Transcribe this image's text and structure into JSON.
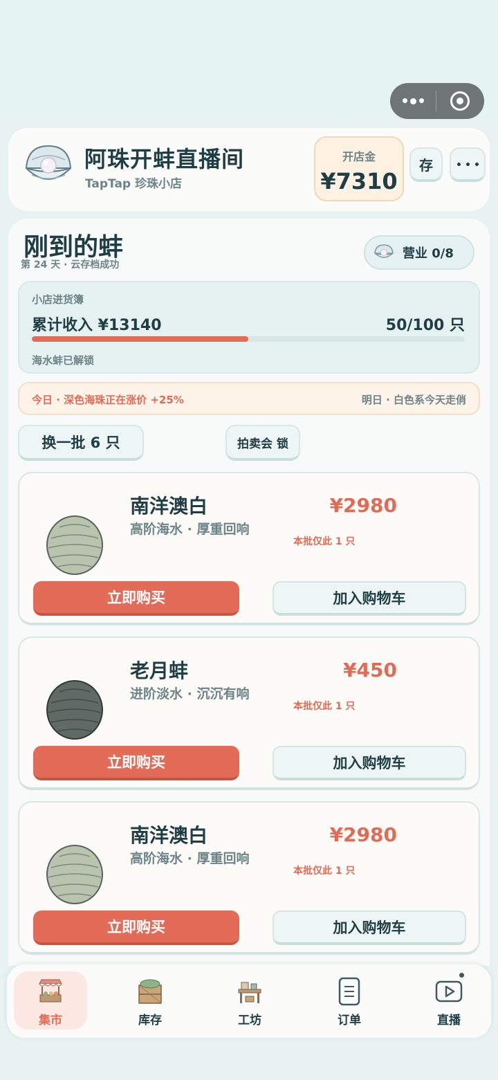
{
  "header": {
    "shop_title": "阿珠开蚌直播间",
    "shop_subtitle": "TapTap 珍珠小店",
    "gold_label": "开店金",
    "gold_value": "¥7310",
    "save_label": "存"
  },
  "page": {
    "title": "刚到的蚌",
    "subtitle": "第 24 天 · 云存档成功",
    "status_label": "营业 0/8"
  },
  "ledger": {
    "title": "小店进货簿",
    "income": "累计收入 ¥13140",
    "count": "50/100 只",
    "progress": 0.5,
    "note": "海水蚌已解锁"
  },
  "market": {
    "today": "今日 · 深色海珠正在涨价 +25%",
    "tomorrow": "明日 · 白色系今天走俏"
  },
  "actions": {
    "refresh_label": "换一批 6 只",
    "auction_label": "拍卖会 锁"
  },
  "products": [
    {
      "name": "南洋澳白",
      "desc": "高阶海水 · 厚重回响",
      "price": "¥2980",
      "stock": "本批仅此 1 只",
      "buy_label": "立即购买",
      "cart_label": "加入购物车",
      "shell_color": "#b9c3ad"
    },
    {
      "name": "老月蚌",
      "desc": "进阶淡水 · 沉沉有响",
      "price": "¥450",
      "stock": "本批仅此 1 只",
      "buy_label": "立即购买",
      "cart_label": "加入购物车",
      "shell_color": "#5f6a66"
    },
    {
      "name": "南洋澳白",
      "desc": "高阶海水 · 厚重回响",
      "price": "¥2980",
      "stock": "本批仅此 1 只",
      "buy_label": "立即购买",
      "cart_label": "加入购物车",
      "shell_color": "#b9c3ad"
    }
  ],
  "tabbar": {
    "tabs": [
      {
        "label": "集市",
        "icon": "market-stall-icon",
        "active": true
      },
      {
        "label": "库存",
        "icon": "crate-icon",
        "active": false
      },
      {
        "label": "工坊",
        "icon": "workbench-icon",
        "active": false
      },
      {
        "label": "订单",
        "icon": "document-icon",
        "active": false
      },
      {
        "label": "直播",
        "icon": "play-icon",
        "active": false
      }
    ]
  },
  "colors": {
    "accent": "#e06b57",
    "text": "#1f3d45",
    "muted": "#6c8488",
    "capsule": "#6f7576"
  }
}
